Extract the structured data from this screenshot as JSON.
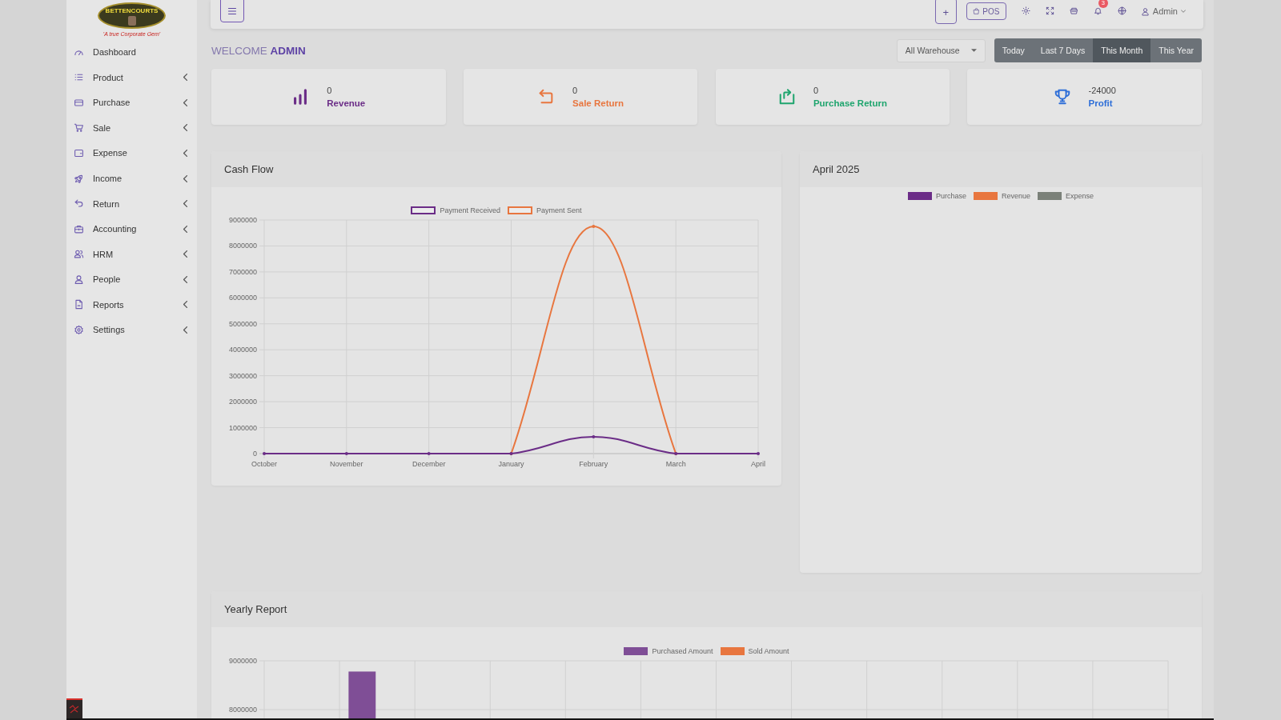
{
  "logo": {
    "name": "BETTENCOURTS",
    "tagline": "'A true Corporate Gem'"
  },
  "sidebar": {
    "items": [
      {
        "label": "Dashboard",
        "expandable": false
      },
      {
        "label": "Product",
        "expandable": true
      },
      {
        "label": "Purchase",
        "expandable": true
      },
      {
        "label": "Sale",
        "expandable": true
      },
      {
        "label": "Expense",
        "expandable": true
      },
      {
        "label": "Income",
        "expandable": true
      },
      {
        "label": "Return",
        "expandable": true
      },
      {
        "label": "Accounting",
        "expandable": true
      },
      {
        "label": "HRM",
        "expandable": true
      },
      {
        "label": "People",
        "expandable": true
      },
      {
        "label": "Reports",
        "expandable": true
      },
      {
        "label": "Settings",
        "expandable": true
      }
    ]
  },
  "top_bar": {
    "add_label": "+",
    "pos_label": "POS",
    "notification_count": "3",
    "user_name": "Admin"
  },
  "welcome": "WELCOME **ADMIN**",
  "warehouse_select": {
    "value": "All Warehouse"
  },
  "date_filters": [
    {
      "label": "Today",
      "selected": false
    },
    {
      "label": "Last 7 Days",
      "selected": false
    },
    {
      "label": "This Month",
      "selected": true
    },
    {
      "label": "This Year",
      "selected": false
    }
  ],
  "stats": [
    {
      "value": "0",
      "label": "Revenue",
      "color": "#6b2d87"
    },
    {
      "value": "0",
      "label": "Sale Return",
      "color": "#e8763f"
    },
    {
      "value": "0",
      "label": "Purchase Return",
      "color": "#1fa56e"
    },
    {
      "value": "-24000",
      "label": "Profit",
      "color": "#2f6fd8"
    }
  ],
  "cash_flow": {
    "title": "Cash Flow",
    "chart_data": {
      "type": "line",
      "categories": [
        "October",
        "November",
        "December",
        "January",
        "February",
        "March",
        "April"
      ],
      "series": [
        {
          "name": "Payment Received",
          "color": "#6b2d87",
          "values": [
            0,
            0,
            0,
            0,
            650000,
            0,
            0
          ]
        },
        {
          "name": "Payment Sent",
          "color": "#e8763f",
          "values": [
            null,
            null,
            null,
            0,
            8750000,
            0,
            null
          ]
        }
      ],
      "ylim": [
        0,
        9000000
      ],
      "yticks": [
        0,
        1000000,
        2000000,
        3000000,
        4000000,
        5000000,
        6000000,
        7000000,
        8000000,
        9000000
      ],
      "grid": true,
      "legend": "top"
    }
  },
  "monthly_summary": {
    "title": "April 2025",
    "legend": [
      {
        "label": "Purchase",
        "color": "#6b2d87"
      },
      {
        "label": "Revenue",
        "color": "#e8763f"
      },
      {
        "label": "Expense",
        "color": "#7b8179"
      }
    ]
  },
  "yearly_report": {
    "title": "Yearly Report",
    "chart_data": {
      "type": "bar",
      "series": [
        {
          "name": "Purchased Amount",
          "color": "#7f4e96",
          "values": [
            null,
            8780000,
            null,
            null,
            null,
            null,
            null,
            null,
            null,
            null,
            null,
            null
          ]
        },
        {
          "name": "Sold Amount",
          "color": "#e8763f",
          "values": [
            null,
            null,
            null,
            null,
            null,
            null,
            null,
            null,
            null,
            null,
            null,
            null
          ]
        }
      ],
      "ylim": [
        7820000,
        9000000
      ],
      "yticks": [
        8000000,
        9000000
      ],
      "grid": true,
      "legend": "top"
    }
  }
}
